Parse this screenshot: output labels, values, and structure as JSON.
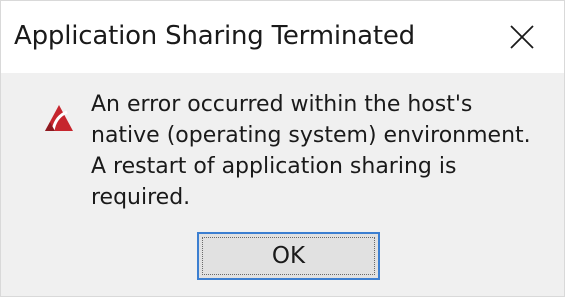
{
  "window": {
    "title": "Application Sharing Terminated",
    "close_icon": "close-icon"
  },
  "dialog": {
    "icon": "error-icon",
    "message": "An error occurred within the host's\nnative (operating system) environment.\nA restart of application sharing is\nrequired.",
    "ok_label": "OK"
  },
  "colors": {
    "accent_border": "#3c7fd1",
    "icon_red": "#c6262e",
    "dialog_background": "#f0f0f0"
  }
}
